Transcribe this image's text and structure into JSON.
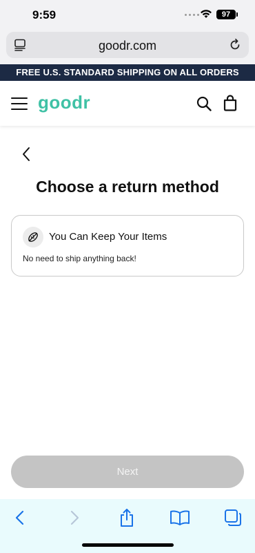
{
  "status_bar": {
    "time": "9:59",
    "battery": "97"
  },
  "browser": {
    "url": "goodr.com"
  },
  "promo": {
    "text": "FREE U.S. STANDARD SHIPPING ON ALL ORDERS"
  },
  "header": {
    "logo": "goodr"
  },
  "page": {
    "title": "Choose a return method",
    "option": {
      "title": "You Can Keep Your Items",
      "description": "No need to ship anything back!"
    },
    "next_label": "Next"
  },
  "colors": {
    "banner": "#1c2a44",
    "logo": "#3fc1a5",
    "toolbar": "#e9fbfd",
    "toolbar_icons": "#1a73e8",
    "next_disabled": "#c4c4c4"
  }
}
